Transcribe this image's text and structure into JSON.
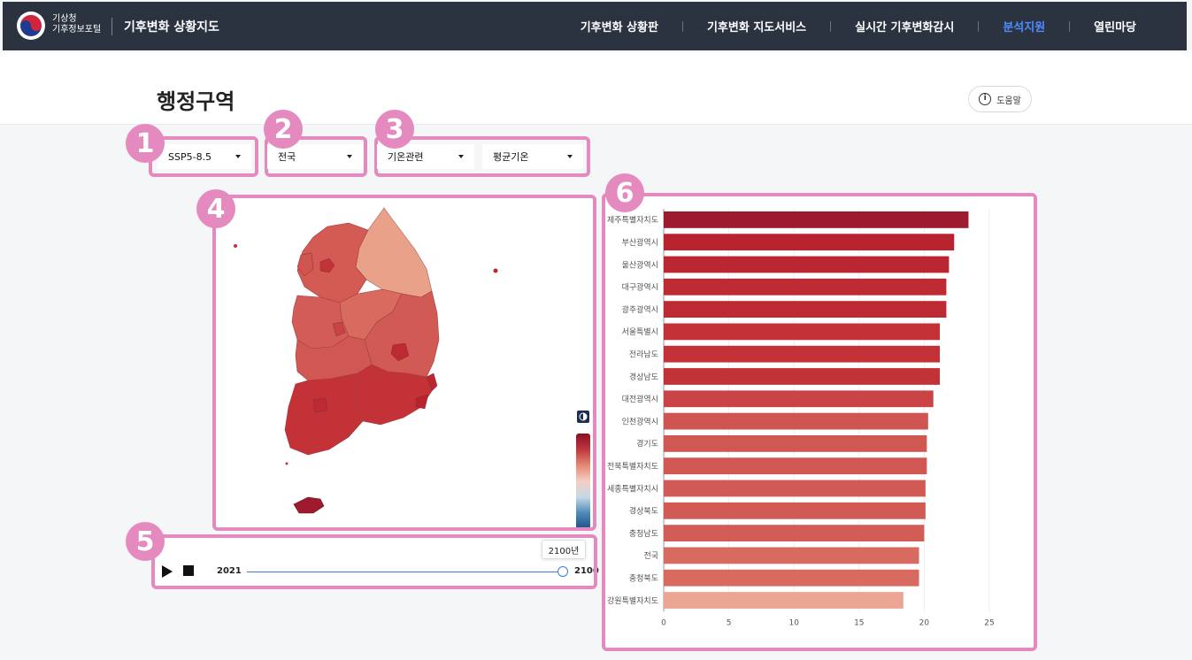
{
  "nav": {
    "logo_line1": "기상청",
    "logo_line2": "기후정보포털",
    "site_title": "기후변화 상황지도",
    "menu": [
      {
        "label": "기후변화 상황판",
        "active": false
      },
      {
        "label": "기후변화 지도서비스",
        "active": false
      },
      {
        "label": "실시간 기후변화감시",
        "active": false
      },
      {
        "label": "분석지원",
        "active": true
      },
      {
        "label": "열린마당",
        "active": false
      }
    ]
  },
  "header": {
    "page_title": "행정구역",
    "help_label": "도움말"
  },
  "badges": [
    "1",
    "2",
    "3",
    "4",
    "5",
    "6"
  ],
  "filters": {
    "scenario": "SSP5-8.5",
    "region": "전국",
    "category": "기온관련",
    "variable": "평균기온"
  },
  "map": {
    "legend_icon": "contrast-icon",
    "colors": {
      "dark": "#a71d2e",
      "mid": "#c93a40",
      "light": "#d45a54",
      "pale": "#e9a18a"
    }
  },
  "timeline": {
    "start_label": "2021",
    "end_label": "2100",
    "tooltip": "2100년",
    "value": 2100
  },
  "chart_data": {
    "type": "bar",
    "orientation": "horizontal",
    "categories": [
      "제주특별자치도",
      "부산광역시",
      "울산광역시",
      "대구광역시",
      "광주광역시",
      "서울특별시",
      "전라남도",
      "경상남도",
      "대전광역시",
      "인천광역시",
      "경기도",
      "전북특별자치도",
      "세종특별자치시",
      "경상북도",
      "충청남도",
      "전국",
      "충청북도",
      "강원특별자치도"
    ],
    "category_labels": [
      "제주특별자치도",
      "부산광역시",
      "울산광역시",
      "대구광역시",
      "광주광역시",
      "서울특별시",
      "전라남도",
      "경상남도",
      "대전광역시",
      "인천광역시",
      "경기도",
      "전북특별자치도",
      "세종특별자치시",
      "경상북도",
      "충청남도",
      "전국",
      "충청북도",
      "강원특별자치도"
    ],
    "values": [
      23.4,
      22.3,
      21.9,
      21.7,
      21.7,
      21.2,
      21.2,
      21.2,
      20.7,
      20.3,
      20.2,
      20.2,
      20.1,
      20.1,
      20.0,
      19.6,
      19.6,
      18.4
    ],
    "colors": [
      "#9e1a2e",
      "#b8232f",
      "#bb2731",
      "#be2a33",
      "#be2a33",
      "#c33237",
      "#c33237",
      "#c33237",
      "#ca4445",
      "#d05550",
      "#d15852",
      "#d15852",
      "#d25a54",
      "#d25a54",
      "#d35d56",
      "#d86a60",
      "#d86a60",
      "#eba592"
    ],
    "xlim": [
      0,
      25
    ],
    "xticks": [
      0,
      5,
      10,
      15,
      20,
      25
    ],
    "grid": true
  }
}
